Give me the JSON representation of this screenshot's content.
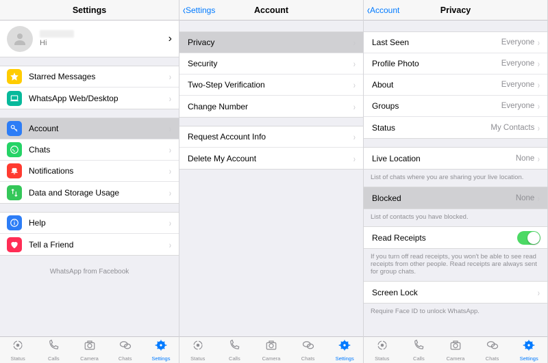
{
  "pane1": {
    "title": "Settings",
    "profile_sub": "Hi",
    "groups": [
      [
        {
          "key": "starred",
          "label": "Starred Messages",
          "iconColor": "#ffcc00",
          "icon": "star"
        },
        {
          "key": "webdesktop",
          "label": "WhatsApp Web/Desktop",
          "iconColor": "#07b99b",
          "icon": "laptop"
        }
      ],
      [
        {
          "key": "account",
          "label": "Account",
          "iconColor": "#2d7df6",
          "icon": "key",
          "selected": true
        },
        {
          "key": "chats",
          "label": "Chats",
          "iconColor": "#25d366",
          "icon": "whatsapp"
        },
        {
          "key": "notifications",
          "label": "Notifications",
          "iconColor": "#ff3b30",
          "icon": "bell"
        },
        {
          "key": "data",
          "label": "Data and Storage Usage",
          "iconColor": "#34c759",
          "icon": "arrows"
        }
      ],
      [
        {
          "key": "help",
          "label": "Help",
          "iconColor": "#2d7df6",
          "icon": "info"
        },
        {
          "key": "tell",
          "label": "Tell a Friend",
          "iconColor": "#ff2d55",
          "icon": "heart"
        }
      ]
    ],
    "footer": "WhatsApp from Facebook"
  },
  "pane2": {
    "back": "Settings",
    "title": "Account",
    "groups": [
      [
        {
          "key": "privacy",
          "label": "Privacy",
          "selected": true
        },
        {
          "key": "security",
          "label": "Security"
        },
        {
          "key": "twostep",
          "label": "Two-Step Verification"
        },
        {
          "key": "changenum",
          "label": "Change Number"
        }
      ],
      [
        {
          "key": "reqinfo",
          "label": "Request Account Info"
        },
        {
          "key": "delete",
          "label": "Delete My Account"
        }
      ]
    ]
  },
  "pane3": {
    "back": "Account",
    "title": "Privacy",
    "visibility": [
      {
        "key": "lastseen",
        "label": "Last Seen",
        "value": "Everyone"
      },
      {
        "key": "profilephoto",
        "label": "Profile Photo",
        "value": "Everyone"
      },
      {
        "key": "about",
        "label": "About",
        "value": "Everyone"
      },
      {
        "key": "groups",
        "label": "Groups",
        "value": "Everyone"
      },
      {
        "key": "status",
        "label": "Status",
        "value": "My Contacts"
      }
    ],
    "liveloc": {
      "label": "Live Location",
      "value": "None",
      "note": "List of chats where you are sharing your live location."
    },
    "blocked": {
      "label": "Blocked",
      "value": "None",
      "note": "List of contacts you have blocked."
    },
    "readreceipts": {
      "label": "Read Receipts",
      "note": "If you turn off read receipts, you won't be able to see read receipts from other people. Read receipts are always sent for group chats."
    },
    "screenlock": {
      "label": "Screen Lock",
      "note": "Require Face ID to unlock WhatsApp."
    }
  },
  "tabs": [
    {
      "key": "status",
      "label": "Status",
      "icon": "status"
    },
    {
      "key": "calls",
      "label": "Calls",
      "icon": "phone"
    },
    {
      "key": "camera",
      "label": "Camera",
      "icon": "camera"
    },
    {
      "key": "chats-tab",
      "label": "Chats",
      "icon": "chatbubbles"
    },
    {
      "key": "settings-tab",
      "label": "Settings",
      "icon": "gear",
      "active": true
    }
  ]
}
